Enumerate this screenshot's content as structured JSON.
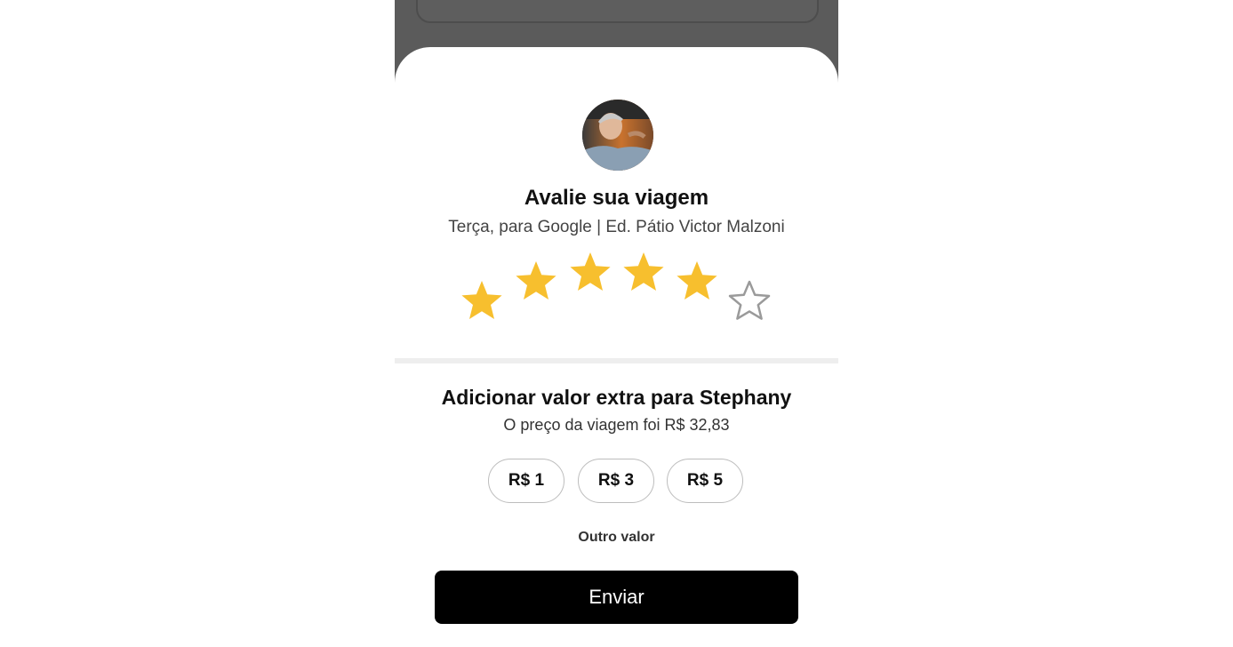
{
  "rating": {
    "title": "Avalie sua viagem",
    "subtitle": "Terça, para Google | Ed. Pátio Victor Malzoni",
    "stars_filled": 5,
    "stars_total": 6,
    "star_color": "#f7bf2e",
    "empty_star_color": "#9a9a9a"
  },
  "tip": {
    "title": "Adicionar valor extra para Stephany",
    "subtitle": "O preço da viagem foi R$ 32,83",
    "options": [
      "R$ 1",
      "R$ 3",
      "R$ 5"
    ],
    "other_label": "Outro valor"
  },
  "submit": {
    "label": "Enviar"
  },
  "colors": {
    "overlay": "#5b5b5b",
    "button_bg": "#000000",
    "button_text": "#ffffff"
  }
}
